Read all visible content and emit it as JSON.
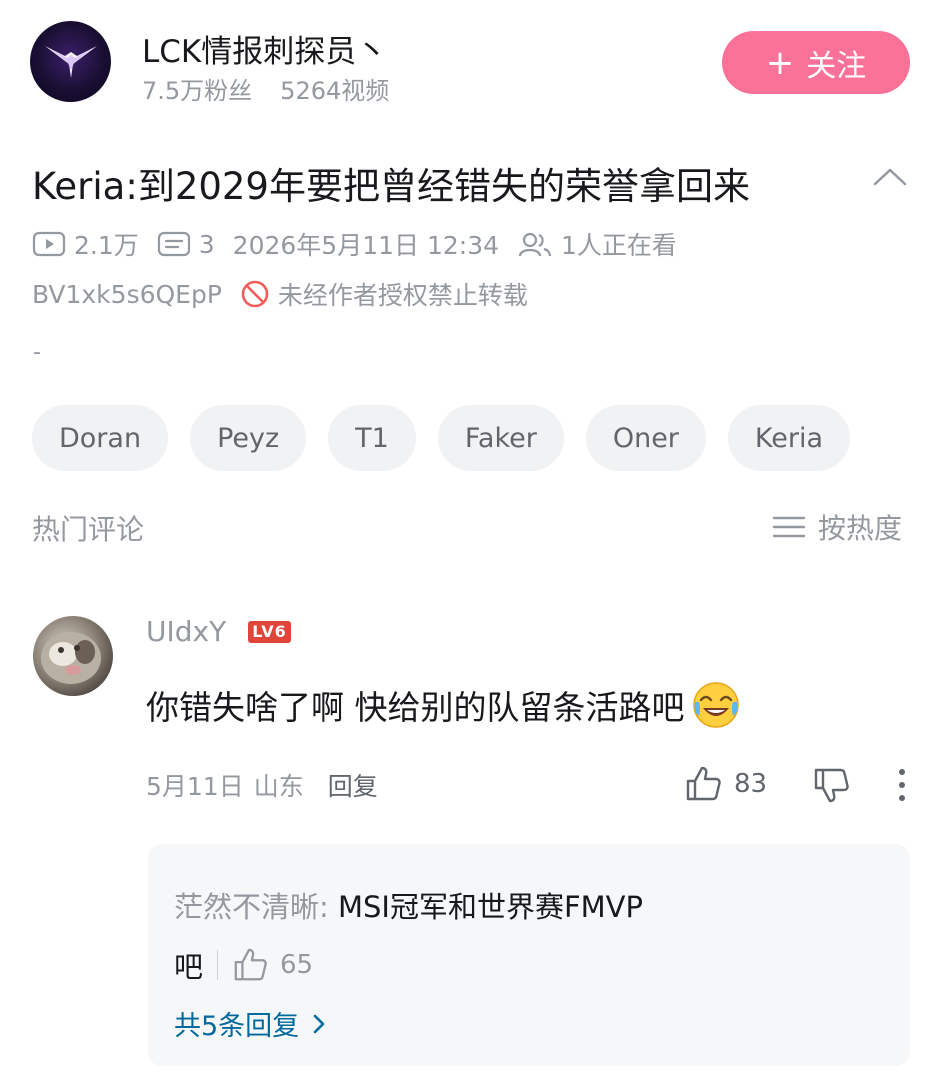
{
  "uploader": {
    "name": "LCK情报刺探员丶",
    "fans": "7.5万粉丝",
    "videos": "5264视频",
    "follow_label": "关注",
    "avatar_icon": "winged-logo-icon"
  },
  "video": {
    "title": "Keria:到2029年要把曾经错失的荣誉拿回来",
    "views": "2.1万",
    "danmaku": "3",
    "datetime": "2026年5月11日 12:34",
    "watching": "1人正在看",
    "bvid": "BV1xk5s6QEpP",
    "copyright_notice": "未经作者授权禁止转载",
    "description": "-",
    "tags": [
      "Doran",
      "Peyz",
      "T1",
      "Faker",
      "Oner",
      "Keria"
    ]
  },
  "comments_section": {
    "title": "热门评论",
    "sort_label": "按热度"
  },
  "comment": {
    "username": "UIdxY",
    "level": "LV6",
    "text": "你错失啥了啊  快给别的队留条活路吧",
    "emoji": "laughing-crying-emoji-icon",
    "date": "5月11日",
    "location": "山东",
    "reply_label": "回复",
    "likes": "83",
    "reply": {
      "author": "茫然不清晰:",
      "text_line1": " MSI冠军和世界赛FMVP",
      "text_line2": "吧",
      "likes": "65",
      "more_label": "共5条回复"
    }
  },
  "colors": {
    "accent_pink": "#fb7299",
    "link_blue": "#00699d",
    "secondary_text": "#9499a0",
    "level_badge": "#e0453a"
  }
}
